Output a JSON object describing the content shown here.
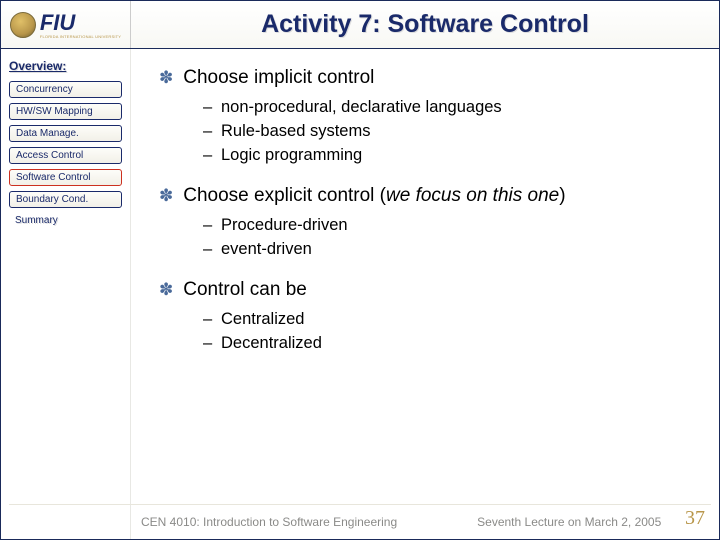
{
  "header": {
    "logo_text": "FIU",
    "logo_sub": "FLORIDA INTERNATIONAL UNIVERSITY",
    "title": "Activity 7: Software Control"
  },
  "sidebar": {
    "heading": "Overview:",
    "items": [
      {
        "label": "Concurrency",
        "active": false
      },
      {
        "label": "HW/SW Mapping",
        "active": false
      },
      {
        "label": "Data Manage.",
        "active": false
      },
      {
        "label": "Access Control",
        "active": false
      },
      {
        "label": "Software Control",
        "active": true
      },
      {
        "label": "Boundary Cond.",
        "active": false
      }
    ],
    "summary_label": "Summary"
  },
  "content": {
    "b1": {
      "text": "Choose implicit control",
      "subs": [
        "non-procedural, declarative languages",
        "Rule-based systems",
        "Logic programming"
      ]
    },
    "b2": {
      "text_a": "Choose explicit control (",
      "text_i": "we focus on this one",
      "text_b": ")",
      "subs": [
        "Procedure-driven",
        "event-driven"
      ]
    },
    "b3": {
      "text": "Control can be",
      "subs": [
        "Centralized",
        "Decentralized"
      ]
    }
  },
  "footer": {
    "course": "CEN 4010: Introduction to Software Engineering",
    "lecture": "Seventh Lecture on March 2, 2005",
    "page": "37"
  }
}
